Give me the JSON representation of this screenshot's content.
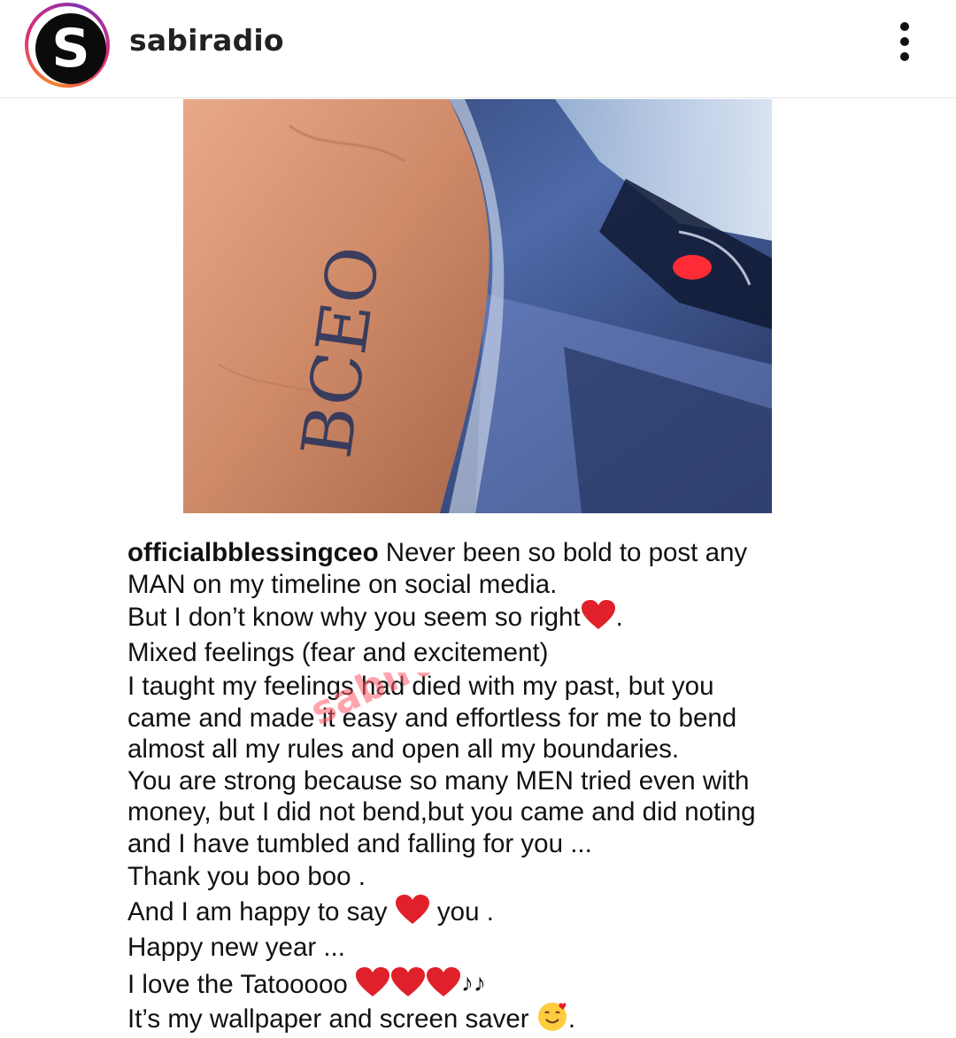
{
  "header": {
    "avatar_letter": "S",
    "username": "sabiradio",
    "more_icon": "more-vertical-icon"
  },
  "post": {
    "image_alt": "Hand with BCEO tattoo",
    "tattoo_text": "BCEO",
    "watermark_text": "sabiradio",
    "caption": {
      "handle": "officialbblessingceo",
      "l1": " Never been so bold to post any",
      "l2": "MAN on my timeline on social media.",
      "l3": "But I don’t know why you seem so right",
      "l3_end": ".",
      "l4": "Mixed feelings (fear and excitement)",
      "l5": "I taught my feelings had died with my past, but you",
      "l6": "came and made it easy and effortless for me to bend",
      "l7": "almost all my rules and open all my boundaries.",
      "l8": "You are strong because so many MEN  tried even with",
      "l9": "money, but I did not bend,but you came and did noting",
      "l10": "and I have tumbled and falling for you ...",
      "l11": "Thank you boo boo .",
      "l12a": "And I am happy to say ",
      "l12b": " you .",
      "l13": "Happy new year ...",
      "l14": "I love the Tatooooo ",
      "l14_music": "♪♪",
      "l15": "It’s my wallpaper and screen saver ",
      "l15_end": "."
    }
  },
  "colors": {
    "heart": "#e0202a",
    "watermark": "#ff5a6a"
  }
}
